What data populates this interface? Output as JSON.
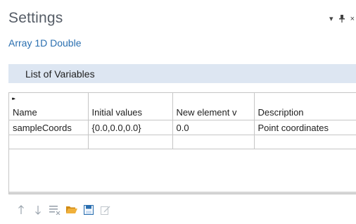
{
  "window": {
    "title": "Settings",
    "subtitle": "Array 1D Double",
    "controls": {
      "dropdown": "▾",
      "pin": "⊥",
      "close": "×"
    }
  },
  "section": {
    "label": "List of Variables"
  },
  "table": {
    "expand_glyph": "▸▸",
    "columns": [
      "Name",
      "Initial values",
      "New element v",
      "Description"
    ],
    "rows": [
      [
        "sampleCoords",
        "{0.0,0.0,0.0}",
        "0.0",
        "Point coordinates"
      ],
      [
        "",
        "",
        "",
        ""
      ]
    ]
  },
  "toolbar": {
    "icons": [
      "move-up-icon",
      "move-down-icon",
      "clear-table-icon",
      "open-folder-icon",
      "save-icon",
      "edit-icon"
    ]
  },
  "colors": {
    "accent": "#2a6fb0",
    "section_bg": "#dde6f2",
    "folder": "#e8a020",
    "save": "#2a6fb0"
  }
}
